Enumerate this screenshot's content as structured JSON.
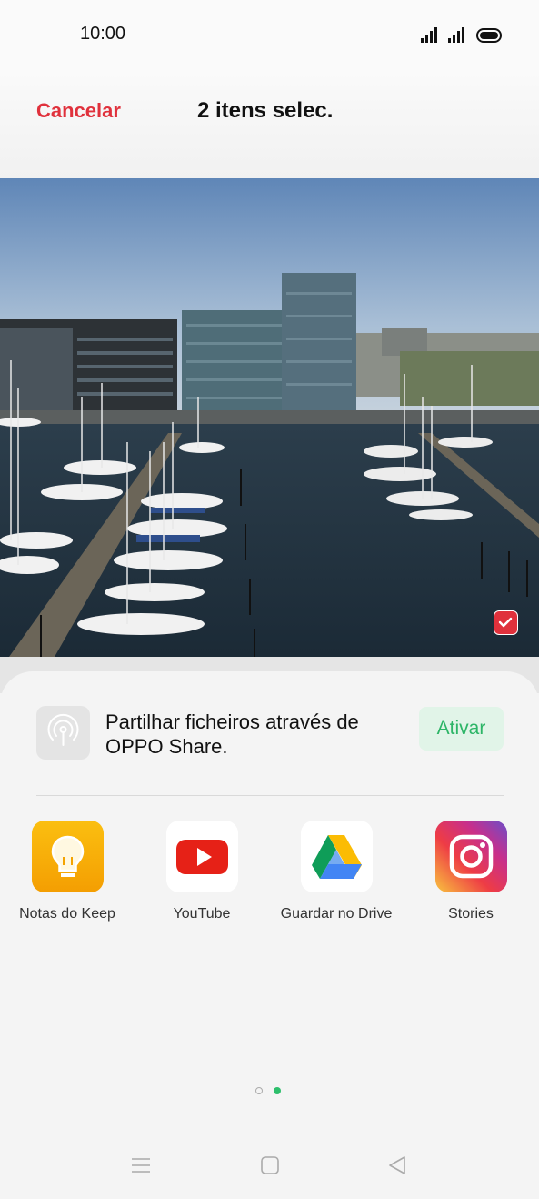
{
  "status_bar": {
    "time": "10:00",
    "icons": [
      "signal-icon",
      "signal-icon",
      "battery-icon"
    ]
  },
  "header": {
    "cancel_label": "Cancelar",
    "title": "2 itens selec."
  },
  "photo": {
    "description_icon": "harbor-photo",
    "selected": true
  },
  "share_panel": {
    "oppo_share_text": "Partilhar ficheiros através de OPPO Share.",
    "activate_label": "Ativar",
    "apps": [
      {
        "label": "Notas do Keep",
        "icon": "keep-icon"
      },
      {
        "label": "YouTube",
        "icon": "youtube-icon"
      },
      {
        "label": "Guardar no Drive",
        "icon": "drive-icon"
      },
      {
        "label": "Stories",
        "icon": "instagram-icon"
      }
    ],
    "page_indicator": {
      "pages": 2,
      "current": 2
    }
  },
  "nav_bar": {
    "buttons": [
      "menu-icon",
      "home-icon",
      "back-icon"
    ]
  },
  "colors": {
    "accent_red": "#e0313c",
    "accent_green": "#2db567"
  }
}
